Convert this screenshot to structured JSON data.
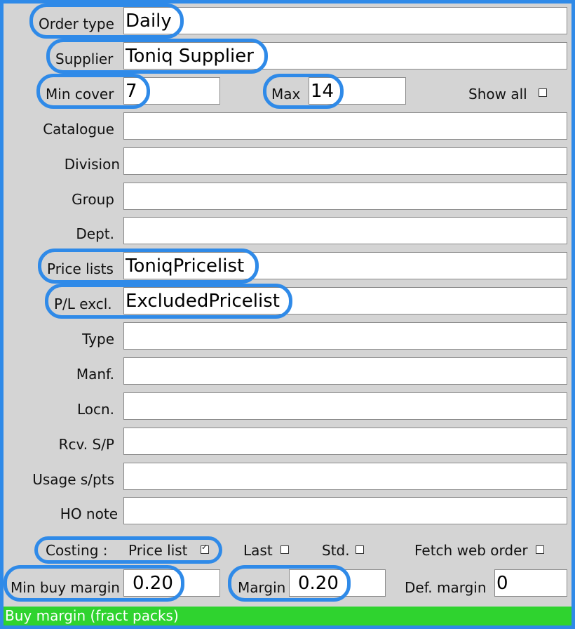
{
  "form": {
    "order_type": {
      "label": "Order type",
      "value": "Daily"
    },
    "supplier": {
      "label": "Supplier",
      "value": "Toniq Supplier"
    },
    "min_cover": {
      "label": "Min cover",
      "value": "7"
    },
    "max": {
      "label": "Max",
      "value": "14"
    },
    "show_all": {
      "label": "Show all",
      "checked": false
    },
    "catalogue": {
      "label": "Catalogue",
      "value": ""
    },
    "division": {
      "label": "Division",
      "value": ""
    },
    "group": {
      "label": "Group",
      "value": ""
    },
    "dept": {
      "label": "Dept.",
      "value": ""
    },
    "price_lists": {
      "label": "Price lists",
      "value": "ToniqPricelist"
    },
    "pl_excl": {
      "label": "P/L excl.",
      "value": "ExcludedPricelist"
    },
    "type": {
      "label": "Type",
      "value": ""
    },
    "manf": {
      "label": "Manf.",
      "value": ""
    },
    "locn": {
      "label": "Locn.",
      "value": ""
    },
    "rcv_sp": {
      "label": "Rcv. S/P",
      "value": ""
    },
    "usage_spts": {
      "label": "Usage s/pts",
      "value": ""
    },
    "ho_note": {
      "label": "HO note",
      "value": ""
    },
    "costing": {
      "label": "Costing :",
      "price_list": {
        "label": "Price list",
        "checked": true
      },
      "last": {
        "label": "Last",
        "checked": false
      },
      "std": {
        "label": "Std.",
        "checked": false
      }
    },
    "fetch_web_order": {
      "label": "Fetch web order",
      "checked": false
    },
    "min_buy_margin": {
      "label": "Min buy margin",
      "value": "0.20"
    },
    "margin": {
      "label": "Margin",
      "value": "0.20"
    },
    "def_margin": {
      "label": "Def. margin",
      "value": "0"
    }
  },
  "status_bar": {
    "text": "Buy margin (fract packs)"
  },
  "colors": {
    "highlight": "#2f8ae8",
    "status_bg": "#2fd32f",
    "panel_bg": "#d4d4d4"
  }
}
